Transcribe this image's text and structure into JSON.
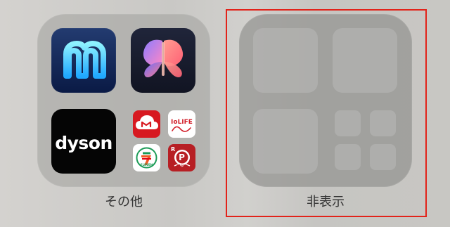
{
  "folders": {
    "other": {
      "label": "その他",
      "apps": {
        "dyson": {
          "name": "dyson"
        }
      },
      "mini_apps": [
        {
          "icon": "cloud-logo-icon"
        },
        {
          "name": "IoLIFE",
          "icon": "iolife-icon"
        },
        {
          "name": "ELEVEN",
          "icon": "seven-eleven-icon"
        },
        {
          "name": "CLUB",
          "badge": "R",
          "letter": "P",
          "icon": "point-club-icon"
        }
      ]
    },
    "hidden": {
      "label": "非表示"
    }
  },
  "accents": {
    "highlight": "#e2231a"
  }
}
